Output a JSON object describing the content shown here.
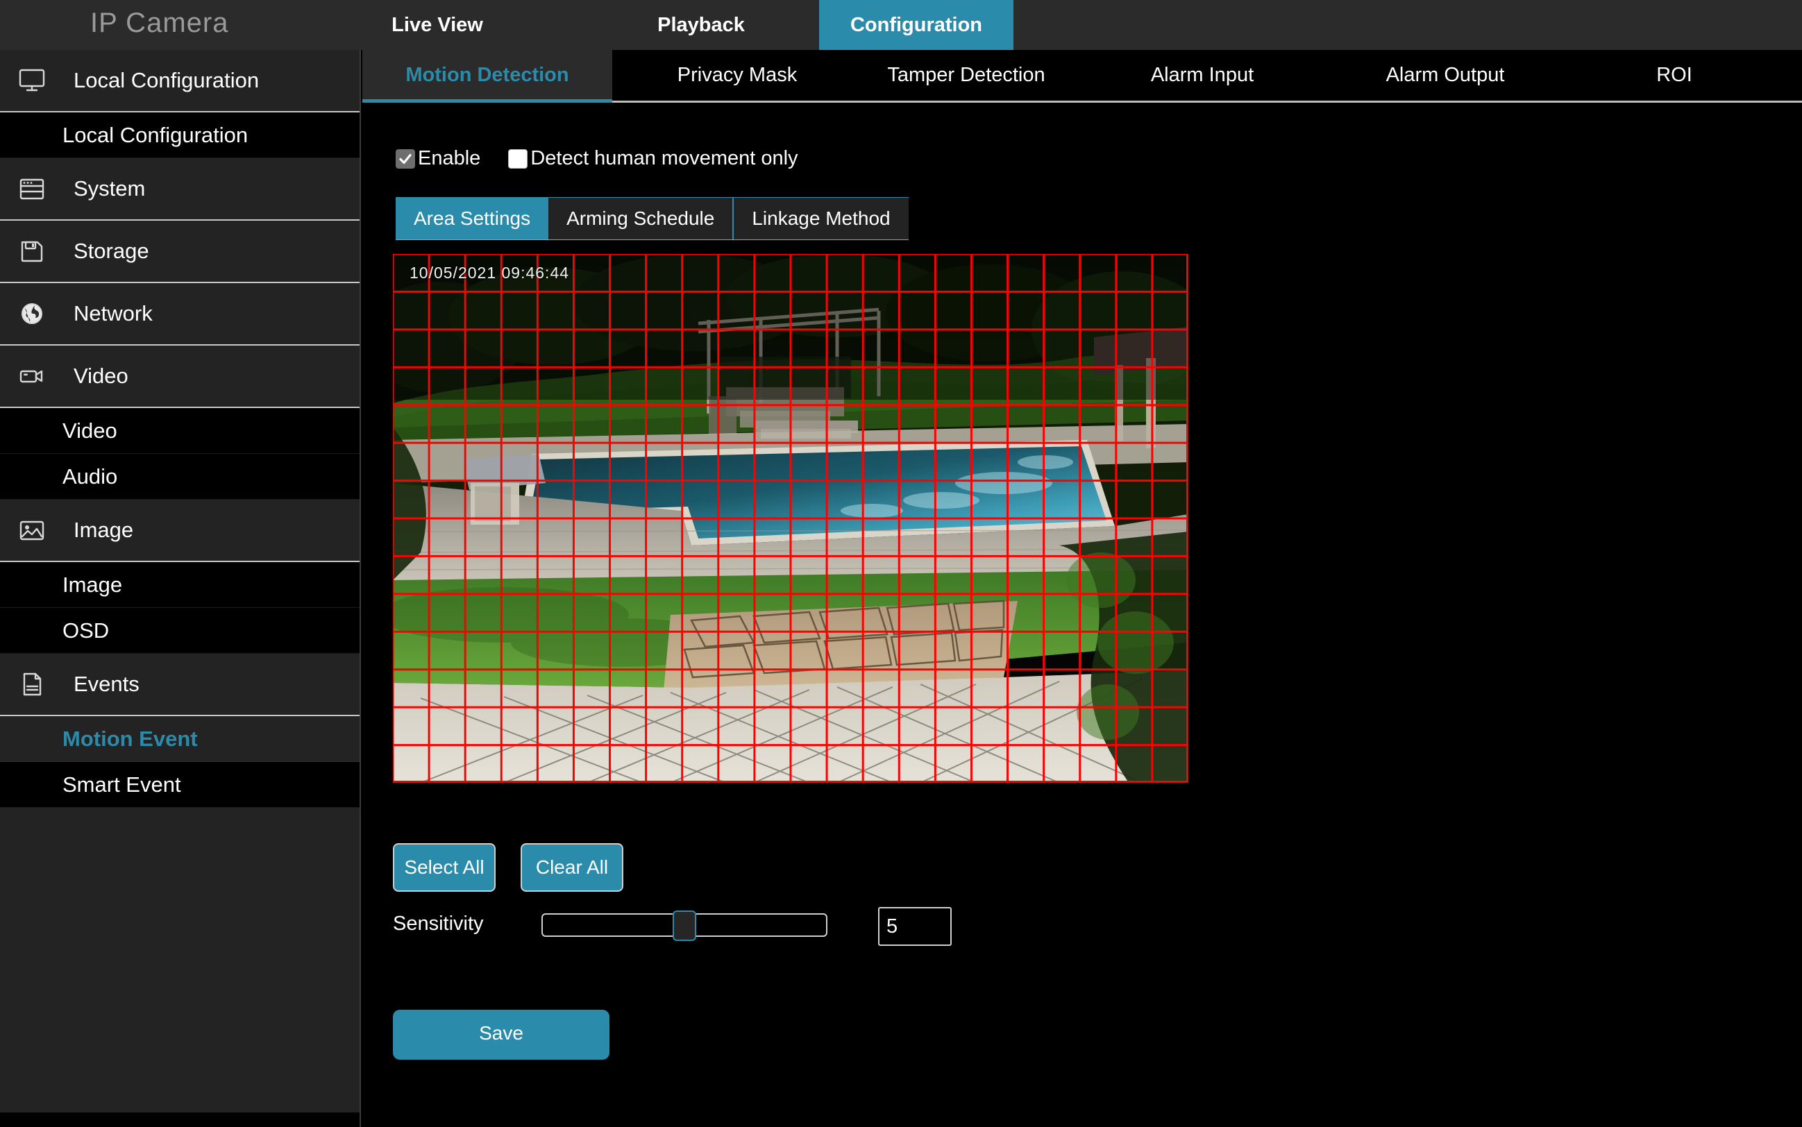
{
  "app": {
    "title": "IP Camera"
  },
  "topnav": [
    {
      "label": "Live View",
      "active": false
    },
    {
      "label": "Playback",
      "active": false
    },
    {
      "label": "Configuration",
      "active": true
    }
  ],
  "sidebar": {
    "groups": [
      {
        "label": "Local Configuration",
        "icon": "monitor-icon",
        "subs": [
          {
            "label": "Local Configuration",
            "active": false
          }
        ]
      },
      {
        "label": "System",
        "icon": "system-window-icon",
        "subs": []
      },
      {
        "label": "Storage",
        "icon": "floppy-disk-icon",
        "subs": []
      },
      {
        "label": "Network",
        "icon": "globe-icon",
        "subs": []
      },
      {
        "label": "Video",
        "icon": "camcorder-icon",
        "subs": [
          {
            "label": "Video",
            "active": false
          },
          {
            "label": "Audio",
            "active": false
          }
        ]
      },
      {
        "label": "Image",
        "icon": "picture-icon",
        "subs": [
          {
            "label": "Image",
            "active": false
          },
          {
            "label": "OSD",
            "active": false
          }
        ]
      },
      {
        "label": "Events",
        "icon": "document-icon",
        "subs": [
          {
            "label": "Motion Event",
            "active": true
          },
          {
            "label": "Smart Event",
            "active": false
          }
        ]
      }
    ]
  },
  "subtabs": [
    {
      "label": "Motion Detection",
      "active": true
    },
    {
      "label": "Privacy Mask",
      "active": false
    },
    {
      "label": "Tamper Detection",
      "active": false
    },
    {
      "label": "Alarm Input",
      "active": false
    },
    {
      "label": "Alarm Output",
      "active": false
    },
    {
      "label": "ROI",
      "active": false
    }
  ],
  "checkboxes": [
    {
      "label": "Enable",
      "checked": true
    },
    {
      "label": "Detect human movement only",
      "checked": false
    }
  ],
  "inner_tabs": [
    {
      "label": "Area Settings",
      "active": true
    },
    {
      "label": "Arming Schedule",
      "active": false
    },
    {
      "label": "Linkage Method",
      "active": false
    }
  ],
  "video": {
    "timestamp": "10/05/2021  09:46:44",
    "grid": {
      "columns": 22,
      "rows": 14,
      "line_color": "#ff0000"
    },
    "scene_description": "backyard swimming pool with hedges, pergola, lawn and stone patio"
  },
  "buttons": {
    "select_all": "Select All",
    "clear_all": "Clear All",
    "save": "Save"
  },
  "sensitivity": {
    "label": "Sensitivity",
    "value": "5",
    "min": 0,
    "max": 10,
    "percent": 50
  },
  "colors": {
    "accent": "#2b8bab",
    "panel": "#232323",
    "topbar": "#2b2b2b",
    "background": "#000000",
    "grid_red": "#ff0000",
    "text": "#ffffff",
    "muted_text": "#9a9a9a"
  }
}
